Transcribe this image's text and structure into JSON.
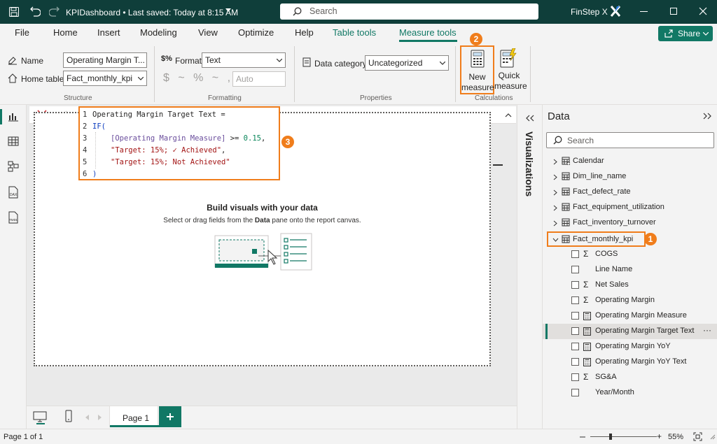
{
  "titlebar": {
    "file_name": "KPIDashboard",
    "saved_status": "• Last saved: Today at 8:15 AM",
    "search_placeholder": "Search",
    "user": "FinStep X"
  },
  "tabs": [
    "File",
    "Home",
    "Insert",
    "Modeling",
    "View",
    "Optimize",
    "Help",
    "Table tools",
    "Measure tools"
  ],
  "active_tab": "Measure tools",
  "share_label": "Share",
  "ribbon": {
    "name_label": "Name",
    "name_value": "Operating Margin T...",
    "home_table_label": "Home table",
    "home_table_value": "Fact_monthly_kpi",
    "structure_label": "Structure",
    "format_label": "Format",
    "format_value": "Text",
    "format_symbols": "$ ~ % ~ ,",
    "decimal_placeholder": "Auto",
    "formatting_label": "Formatting",
    "data_category_label": "Data category",
    "data_category_value": "Uncategorized",
    "properties_label": "Properties",
    "new_measure_line1": "New",
    "new_measure_line2": "measure",
    "quick_measure_line1": "Quick",
    "quick_measure_line2": "measure",
    "calculations_label": "Calculations"
  },
  "badges": {
    "one": "1",
    "two": "2",
    "three": "3"
  },
  "formula": {
    "line_numbers": [
      "1",
      "2",
      "3",
      "4",
      "5",
      "6"
    ],
    "l1": "Operating Margin Target Text =",
    "l2": "IF(",
    "l3_ref": "[Operating Margin Measure]",
    "l3_op": " >= ",
    "l3_num": "0.15",
    "l3_end": ",",
    "l4_str": "\"Target: 15%; ✓ Achieved\"",
    "l4_end": ",",
    "l5_str": "\"Target: 15%; Not Achieved\"",
    "l6": ")"
  },
  "canvas": {
    "empty_title": "Build visuals with your data",
    "empty_sub_a": "Select or drag fields from the ",
    "empty_sub_b": "Data",
    "empty_sub_c": " pane onto the report canvas."
  },
  "page_tab": "Page 1",
  "status": {
    "page": "Page 1 of 1",
    "zoom": "55%"
  },
  "visualizations_label": "Visualizations",
  "data_pane": {
    "title": "Data",
    "search_placeholder": "Search",
    "tables": [
      "Calendar",
      "Dim_line_name",
      "Fact_defect_rate",
      "Fact_equipment_utilization",
      "Fact_inventory_turnover",
      "Fact_monthly_kpi"
    ],
    "fields": [
      {
        "name": "COGS",
        "icon": "sigma"
      },
      {
        "name": "Line Name",
        "icon": "none"
      },
      {
        "name": "Net Sales",
        "icon": "sigma"
      },
      {
        "name": "Operating Margin",
        "icon": "sigma"
      },
      {
        "name": "Operating Margin Measure",
        "icon": "calculator"
      },
      {
        "name": "Operating Margin Target Text",
        "icon": "calculator"
      },
      {
        "name": "Operating Margin YoY",
        "icon": "calculator"
      },
      {
        "name": "Operating Margin YoY Text",
        "icon": "calculator"
      },
      {
        "name": "SG&A",
        "icon": "sigma"
      },
      {
        "name": "Year/Month",
        "icon": "none"
      }
    ],
    "more_label": "···"
  },
  "colors": {
    "accent": "#117865",
    "highlight": "#f07d1b",
    "titlebar": "#0f3e3a"
  }
}
